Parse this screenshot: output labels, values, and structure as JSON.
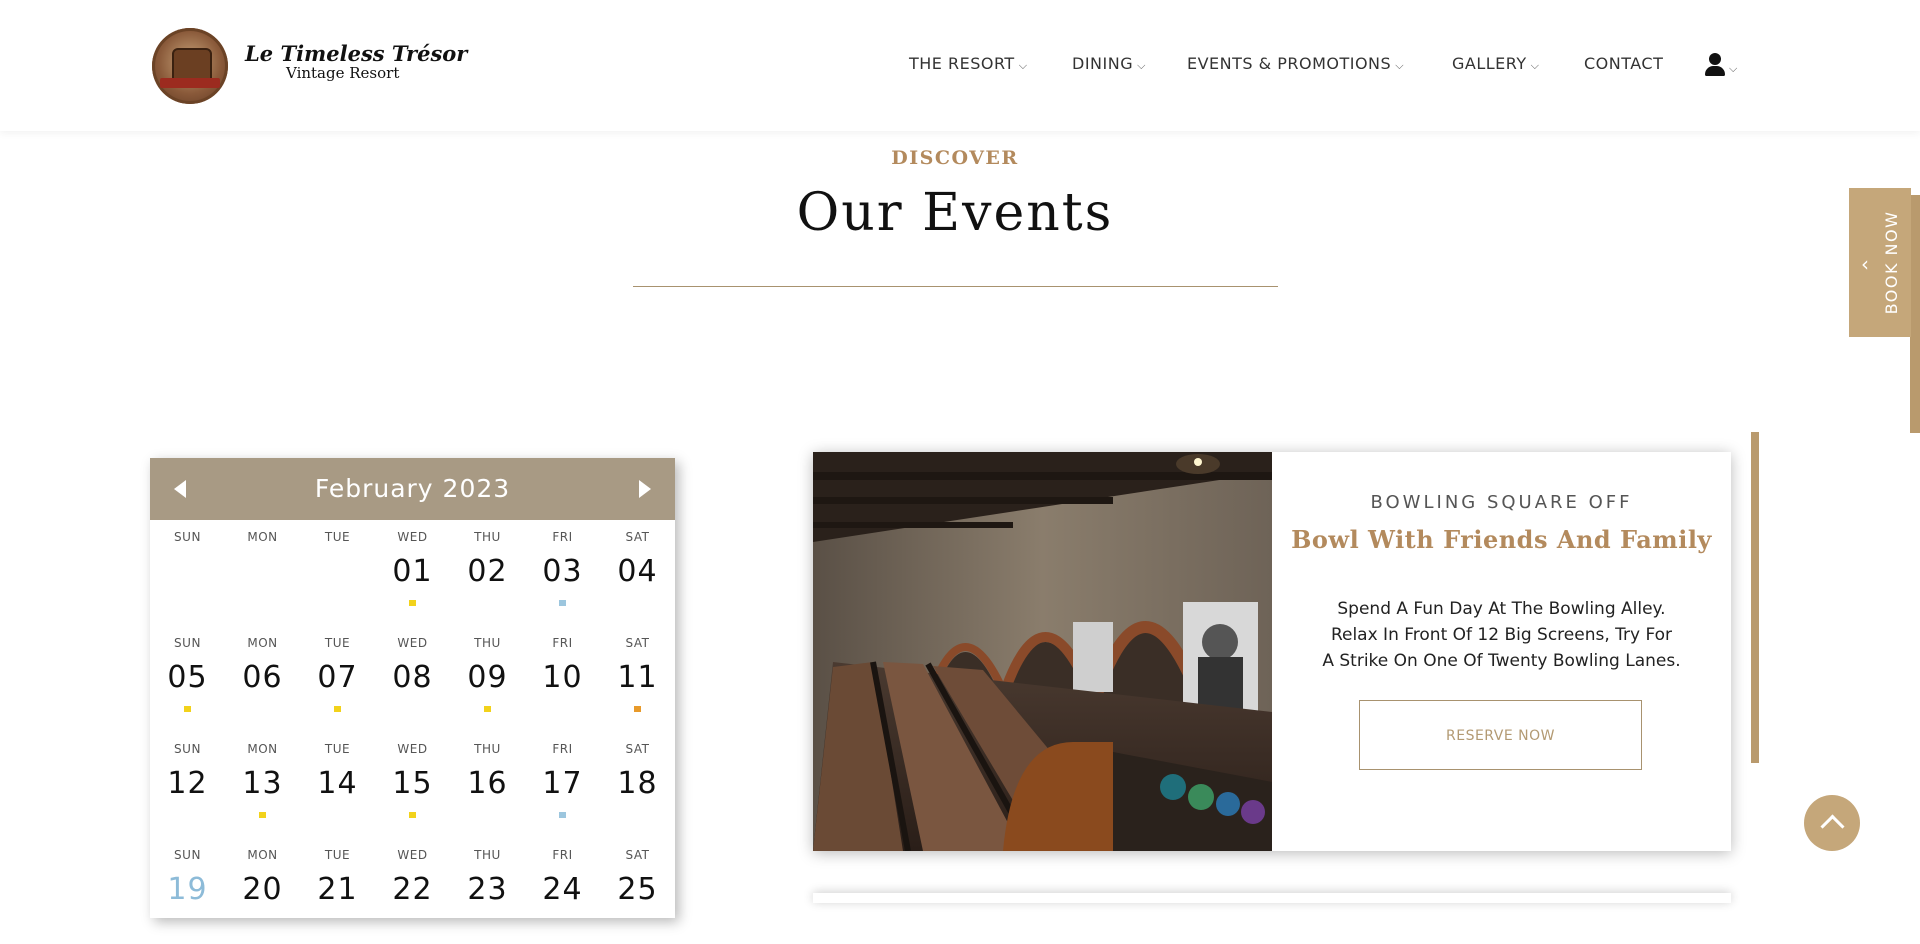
{
  "brand": {
    "name_line1": "Le Timeless Trésor",
    "name_line2": "Vintage Resort",
    "logo_icon": "treasure-chest-logo"
  },
  "nav": {
    "items": [
      {
        "label": "THE RESORT",
        "has_dropdown": true
      },
      {
        "label": "DINING",
        "has_dropdown": true
      },
      {
        "label": "EVENTS & PROMOTIONS",
        "has_dropdown": true
      },
      {
        "label": "GALLERY",
        "has_dropdown": true
      },
      {
        "label": "CONTACT",
        "has_dropdown": false
      }
    ],
    "chevron": "⌵",
    "user_icon": "user-icon"
  },
  "section": {
    "eyebrow": "DISCOVER",
    "title": "Our Events"
  },
  "book_now": {
    "label": "BOOK NOW",
    "arrow": "‹"
  },
  "calendar": {
    "month_label": "February 2023",
    "weeks": [
      [
        {
          "dow": "SUN",
          "date": ""
        },
        {
          "dow": "MON",
          "date": ""
        },
        {
          "dow": "TUE",
          "date": ""
        },
        {
          "dow": "WED",
          "date": "01",
          "dot": "#f2d21b"
        },
        {
          "dow": "THU",
          "date": "02"
        },
        {
          "dow": "FRI",
          "date": "03",
          "dot": "#9cc6de"
        },
        {
          "dow": "SAT",
          "date": "04"
        }
      ],
      [
        {
          "dow": "SUN",
          "date": "05",
          "dot": "#f2d21b"
        },
        {
          "dow": "MON",
          "date": "06"
        },
        {
          "dow": "TUE",
          "date": "07",
          "dot": "#f2d21b"
        },
        {
          "dow": "WED",
          "date": "08"
        },
        {
          "dow": "THU",
          "date": "09",
          "dot": "#f2d21b"
        },
        {
          "dow": "FRI",
          "date": "10"
        },
        {
          "dow": "SAT",
          "date": "11",
          "dot": "#e89a2a"
        }
      ],
      [
        {
          "dow": "SUN",
          "date": "12"
        },
        {
          "dow": "MON",
          "date": "13",
          "dot": "#f2d21b"
        },
        {
          "dow": "TUE",
          "date": "14"
        },
        {
          "dow": "WED",
          "date": "15",
          "dot": "#f2d21b"
        },
        {
          "dow": "THU",
          "date": "16"
        },
        {
          "dow": "FRI",
          "date": "17",
          "dot": "#9cc6de"
        },
        {
          "dow": "SAT",
          "date": "18"
        }
      ],
      [
        {
          "dow": "SUN",
          "date": "19",
          "muted": true
        },
        {
          "dow": "MON",
          "date": "20"
        },
        {
          "dow": "TUE",
          "date": "21"
        },
        {
          "dow": "WED",
          "date": "22"
        },
        {
          "dow": "THU",
          "date": "23"
        },
        {
          "dow": "FRI",
          "date": "24"
        },
        {
          "dow": "SAT",
          "date": "25"
        }
      ]
    ]
  },
  "event": {
    "subtitle": "BOWLING SQUARE OFF",
    "title": "Bowl With Friends And Family",
    "description_lines": [
      "Spend A Fun Day At The Bowling Alley.",
      "Relax In Front Of 12 Big Screens, Try For",
      "A Strike On One Of Twenty Bowling Lanes."
    ],
    "cta": "RESERVE NOW"
  },
  "colors": {
    "accent": "#b38a5d",
    "calendar_header": "#a89a84",
    "button_gold": "#c5a77a"
  },
  "scroll_top_icon": "arrow-up-icon"
}
